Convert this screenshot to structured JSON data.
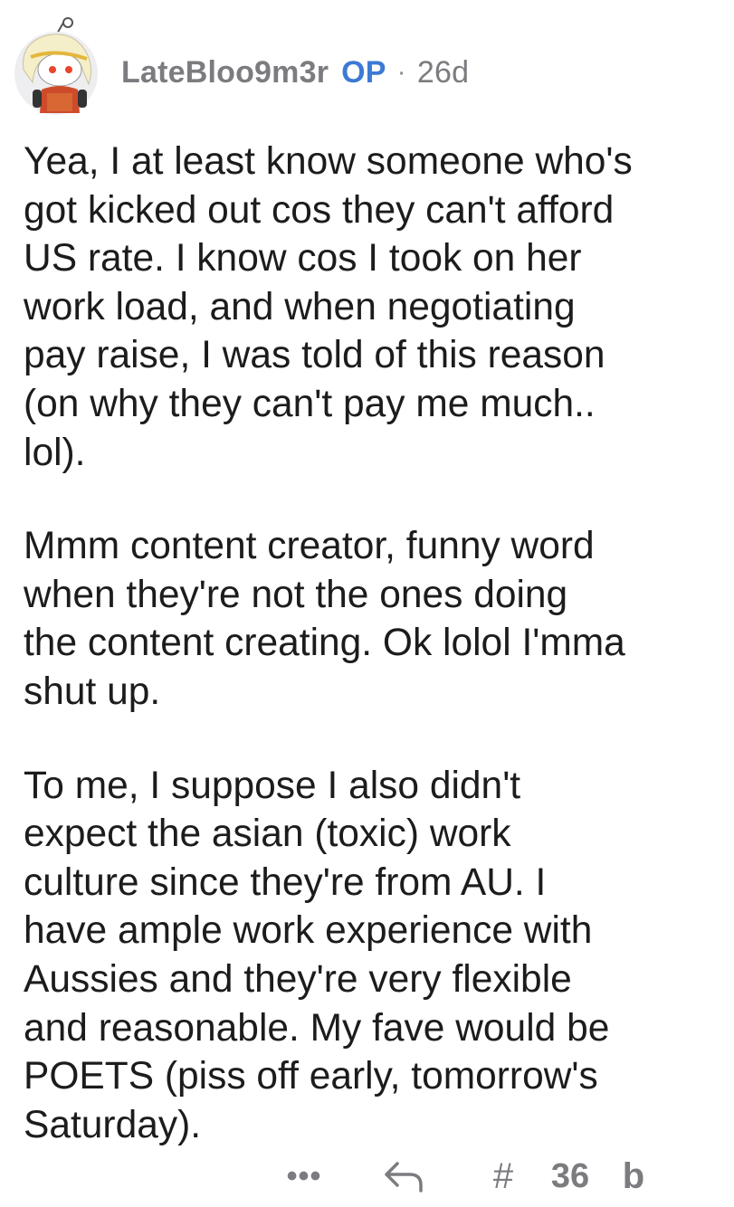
{
  "comment": {
    "username": "LateBloo9m3r",
    "op_badge": "OP",
    "separator": "·",
    "age": "26d",
    "paragraphs": [
      "Yea, I at least know someone who's\ngot kicked out cos they can't afford\nUS rate. I know cos I took on her\nwork load, and when negotiating\npay raise, I was told of this reason\n(on why they can't pay me much..\nlol).",
      "Mmm content creator, funny word\nwhen they're not the ones doing\nthe content creating. Ok lolol I'mma\nshut up.",
      "To me, I suppose I also didn't\nexpect the asian (toxic) work\nculture since they're from AU. I\nhave ample work experience with\nAussies and they're very flexible\nand reasonable. My fave would be\nPOETS (piss off early, tomorrow's\nSaturday)."
    ]
  },
  "actions": {
    "more_label": "•••",
    "reply_icon": "reply-arrow-icon",
    "award_glyph": "#",
    "score": "36",
    "downvote_glyph": "b"
  },
  "colors": {
    "meta_gray": "#7c7c80",
    "op_blue": "#3c7ad4",
    "text": "#1c1c1e"
  }
}
